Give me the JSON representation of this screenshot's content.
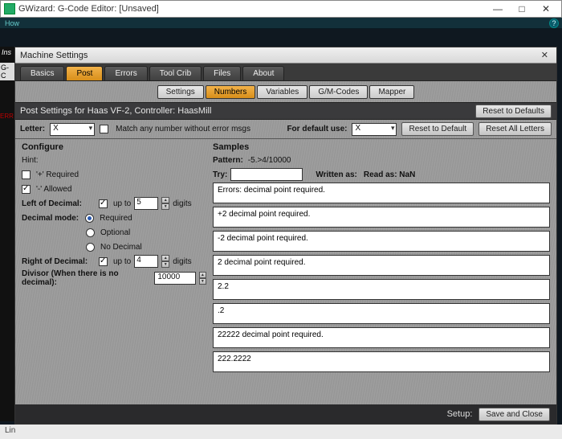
{
  "window": {
    "title": "GWizard: G-Code Editor:  [Unsaved]",
    "min": "—",
    "max": "□",
    "close": "✕"
  },
  "behind": {
    "how": "How",
    "ins": "Ins",
    "gc": "G-C",
    "err": "ERR",
    "lin": "Lin"
  },
  "dialog": {
    "title": "Machine Settings",
    "close": "✕",
    "tabs": [
      "Basics",
      "Post",
      "Errors",
      "Tool Crib",
      "Files",
      "About"
    ],
    "active_tab": 1,
    "subtabs": [
      "Settings",
      "Numbers",
      "Variables",
      "G/M-Codes",
      "Mapper"
    ],
    "active_subtab": 1,
    "header": "Post Settings for Haas VF-2, Controller: HaasMill",
    "reset_defaults": "Reset to Defaults",
    "letter_label": "Letter:",
    "letter_value": "X",
    "match_any": "Match any number without error msgs",
    "match_any_checked": false,
    "default_use_label": "For default use:",
    "default_use_value": "X",
    "reset_default": "Reset to Default",
    "reset_all": "Reset All Letters",
    "configure": {
      "title": "Configure",
      "hint_label": "Hint:",
      "plus_label": "'+' Required",
      "plus_checked": false,
      "dash_label": "'-' Allowed",
      "dash_checked": true,
      "left_label": "Left of Decimal:",
      "left_upto_checked": true,
      "upto": "up to",
      "left_val": "5",
      "digits": "digits",
      "dec_mode_label": "Decimal mode:",
      "dec_required": "Required",
      "dec_optional": "Optional",
      "dec_none": "No Decimal",
      "dec_selected": 0,
      "right_label": "Right of Decimal:",
      "right_upto_checked": true,
      "right_val": "4",
      "divisor_label": "Divisor (When there is no decimal):",
      "divisor_val": "10000"
    },
    "samples": {
      "title": "Samples",
      "pattern_label": "Pattern:",
      "pattern_val": "-5.>4/10000",
      "try_label": "Try:",
      "try_val": "",
      "written_label": "Written as:",
      "read_label": "Read as: NaN",
      "items": [
        "Errors:  decimal point required.",
        "+2  decimal point required.",
        "-2  decimal point required.",
        "2  decimal point required.",
        "2.2",
        ".2",
        "22222  decimal point required.",
        "222.2222"
      ]
    },
    "footer": {
      "setup": "Setup:",
      "save": "Save and Close"
    }
  }
}
